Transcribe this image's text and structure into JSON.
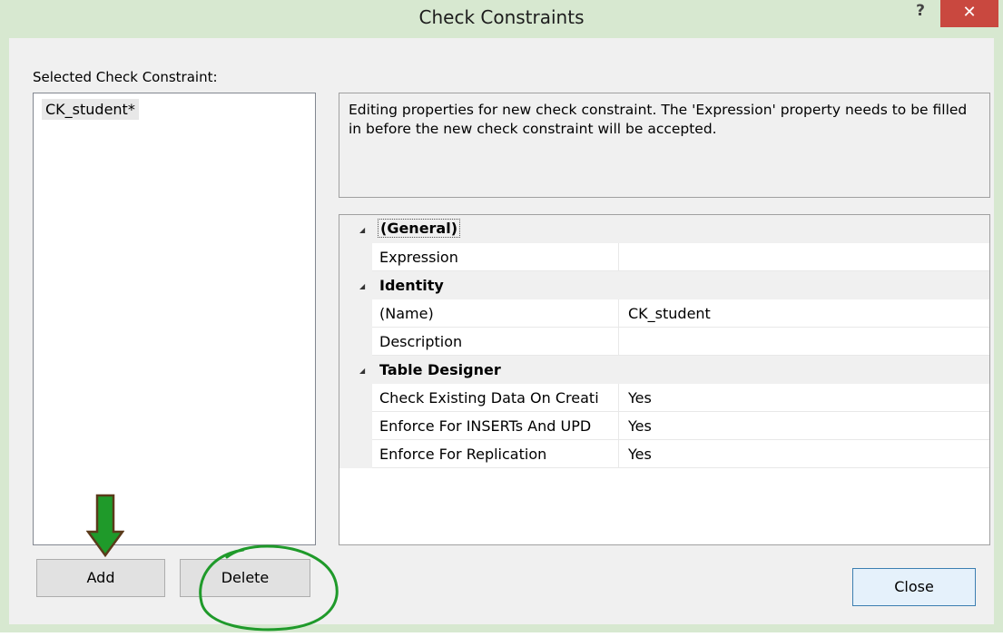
{
  "window": {
    "title": "Check Constraints",
    "help_label": "?",
    "close_label": "✕"
  },
  "left": {
    "label": "Selected Check Constraint:",
    "items": [
      "CK_student*"
    ]
  },
  "description": "Editing properties for new check constraint.  The 'Expression' property needs to be filled in before the new check constraint will be accepted.",
  "grid": {
    "categories": [
      {
        "name": "(General)",
        "properties": [
          {
            "name": "Expression",
            "value": ""
          }
        ]
      },
      {
        "name": "Identity",
        "properties": [
          {
            "name": "(Name)",
            "value": "CK_student"
          },
          {
            "name": "Description",
            "value": ""
          }
        ]
      },
      {
        "name": "Table Designer",
        "properties": [
          {
            "name": "Check Existing Data On Creati",
            "value": "Yes"
          },
          {
            "name": "Enforce For INSERTs And UPD",
            "value": "Yes"
          },
          {
            "name": "Enforce For Replication",
            "value": "Yes"
          }
        ]
      }
    ]
  },
  "buttons": {
    "add": "Add",
    "delete": "Delete",
    "close": "Close"
  },
  "annotations": {
    "arrow_color": "#1f9a2a",
    "arrow_outline": "#5a3a1a",
    "circle_color": "#1f9a2a"
  }
}
